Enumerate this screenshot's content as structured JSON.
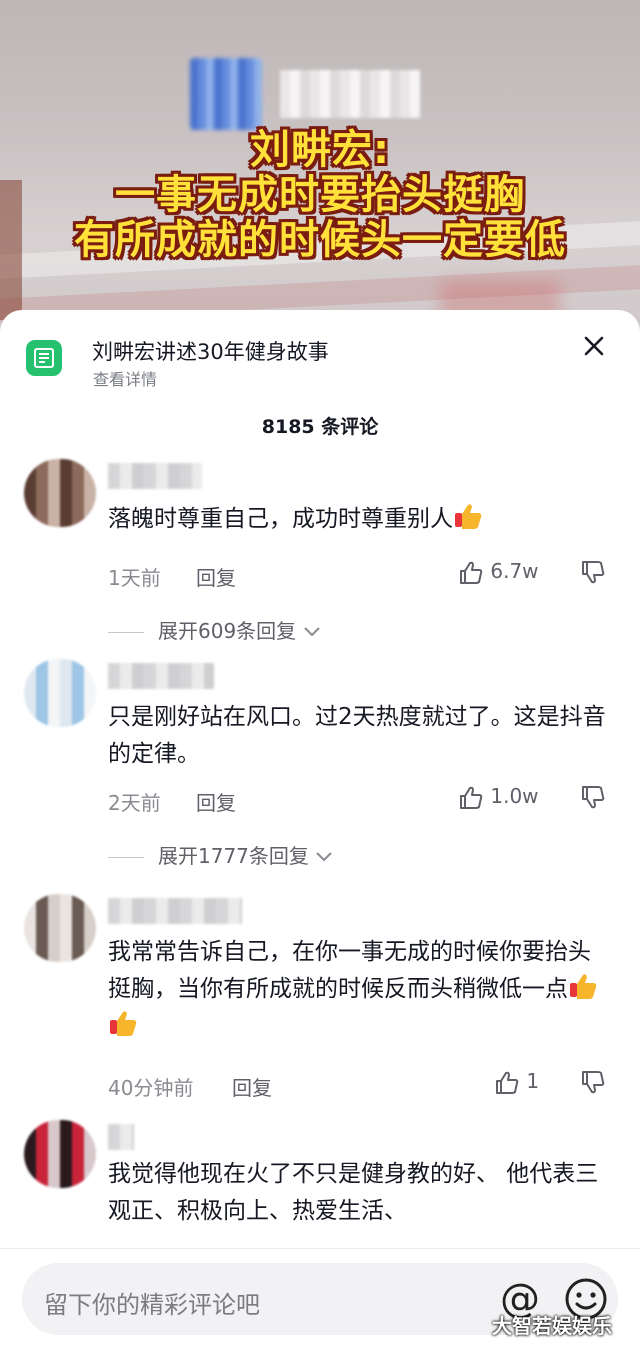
{
  "video": {
    "overlay_lines": [
      "刘畊宏:",
      "一事无成时要抬头挺胸",
      "有所成就的时候头一定要低"
    ]
  },
  "sheet": {
    "header_title": "刘畊宏讲述30年健身故事",
    "header_sub": "查看详情",
    "comment_count": "8185 条评论"
  },
  "comments": [
    {
      "text": "落魄时尊重自己，成功时尊重别人",
      "time": "1天前",
      "reply_label": "回复",
      "likes": "6.7w",
      "expand": "展开609条回复"
    },
    {
      "text": "只是刚好站在风口。过2天热度就过了。这是抖音的定律。",
      "time": "2天前",
      "reply_label": "回复",
      "likes": "1.0w",
      "expand": "展开1777条回复"
    },
    {
      "text": "我常常告诉自己，在你一事无成的时候你要抬头挺胸，当你有所成就的时候反而头稍微低一点",
      "time": "40分钟前",
      "reply_label": "回复",
      "likes": "1"
    },
    {
      "text": "我觉得他现在火了不只是健身教的好、 他代表三观正、积极向上、热爱生活、"
    }
  ],
  "input": {
    "placeholder": "留下你的精彩评论吧",
    "at_symbol": "@"
  },
  "watermark": "大智若娱娱乐",
  "colors": {
    "overlay_text": "#ffe13a",
    "overlay_outline": "#7a1c0f",
    "doc_icon_bg": "#25c16f"
  }
}
